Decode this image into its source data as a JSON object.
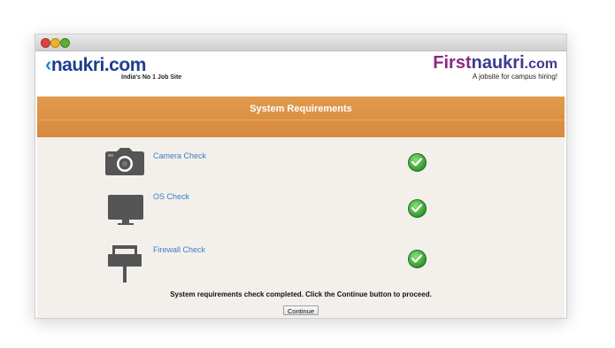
{
  "window": {
    "controls": [
      "close",
      "minimize",
      "zoom"
    ]
  },
  "header": {
    "left_logo": {
      "name": "naukri.com",
      "tagline": "India's No 1 Job Site"
    },
    "right_logo": {
      "first": "First",
      "naukri": "naukri",
      "dotcom": ".com",
      "tagline": "A jobsite for campus hiring!"
    }
  },
  "band": {
    "title": "System Requirements"
  },
  "checks": [
    {
      "label": "Camera Check",
      "icon": "camera-icon",
      "status": "passed"
    },
    {
      "label": "OS Check",
      "icon": "monitor-icon",
      "status": "passed"
    },
    {
      "label": "Firewall Check",
      "icon": "firewall-icon",
      "status": "passed"
    }
  ],
  "status_message": "System requirements check completed. Click the Continue button to proceed.",
  "continue_button": "Continue",
  "colors": {
    "band": "#d98e42",
    "link": "#3a7fc0",
    "check_green": "#2f9a2f",
    "icon_gray": "#555555"
  }
}
